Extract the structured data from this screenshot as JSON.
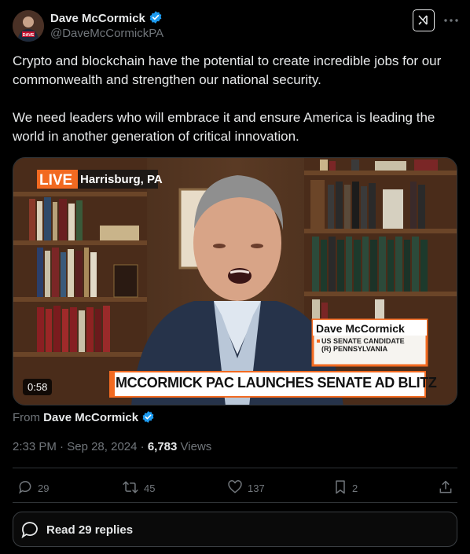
{
  "author": {
    "name": "Dave McCormick",
    "handle": "@DaveMcCormickPA",
    "avatar_badge": "DAVE",
    "verified_color": "#1d9bf0"
  },
  "tweet": {
    "paragraphs": [
      "Crypto and blockchain have the potential to create incredible jobs for our commonwealth and strengthen our national security.",
      "We need leaders who will embrace it and ensure America is leading the world in another generation of critical innovation."
    ]
  },
  "video": {
    "live_label": "LIVE",
    "location": "Harrisburg, PA",
    "lower_third_name": "Dave McCormick",
    "lower_third_line1": "US SENATE CANDIDATE",
    "lower_third_line2": "(R) PENNSYLVANIA",
    "headline": "MCCORMICK PAC LAUNCHES SENATE AD BLITZ",
    "duration": "0:58"
  },
  "source": {
    "prefix": "From",
    "name": "Dave McCormick"
  },
  "meta": {
    "time": "2:33 PM",
    "date": "Sep 28, 2024",
    "views_count": "6,783",
    "views_label": "Views"
  },
  "actions": {
    "replies": "29",
    "reposts": "45",
    "likes": "137",
    "bookmarks": "2"
  },
  "read_replies": {
    "label": "Read 29 replies"
  },
  "icons": {
    "verified": "verified-badge-icon",
    "grok": "grok-icon",
    "more": "more-icon",
    "reply": "reply-icon",
    "repost": "repost-icon",
    "like": "heart-icon",
    "bookmark": "bookmark-icon",
    "share": "share-icon"
  },
  "colors": {
    "accent": "#1d9bf0",
    "live": "#f26a21",
    "muted": "#71767b"
  }
}
